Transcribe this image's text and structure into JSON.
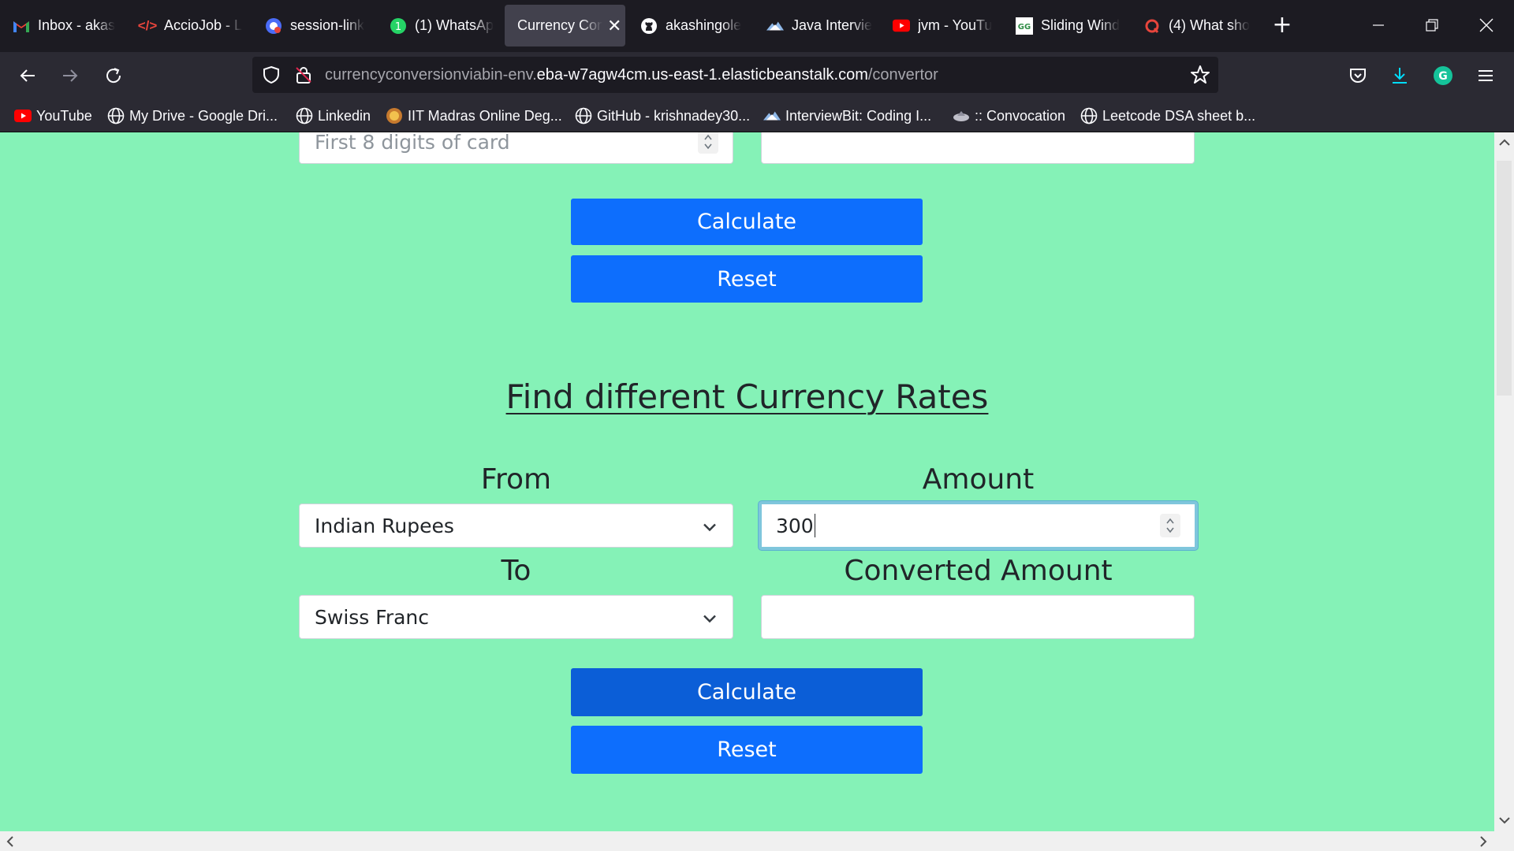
{
  "tabs": [
    {
      "title": "Inbox - akas",
      "icon": "gmail-icon",
      "active": false
    },
    {
      "title": "AccioJob - L",
      "icon": "acciojob-icon",
      "active": false
    },
    {
      "title": "session-link",
      "icon": "session-icon",
      "active": false
    },
    {
      "title": "(1) WhatsAp",
      "icon": "whatsapp-icon",
      "active": false
    },
    {
      "title": "Currency Con",
      "icon": "",
      "active": true
    },
    {
      "title": "akashingole",
      "icon": "github-icon",
      "active": false
    },
    {
      "title": "Java Intervie",
      "icon": "interviewbit-icon",
      "active": false
    },
    {
      "title": "jvm - YouTu",
      "icon": "youtube-icon",
      "active": false
    },
    {
      "title": "Sliding Wind",
      "icon": "gfg-icon",
      "active": false
    },
    {
      "title": "(4) What sho",
      "icon": "quora-icon",
      "active": false
    }
  ],
  "url": {
    "prefix": "currencyconversionviabin-env.",
    "domain": "eba-w7agw4cm.us-east-1.elasticbeanstalk.com",
    "path": "/convertor"
  },
  "bookmarks": [
    {
      "label": "YouTube",
      "icon": "youtube-icon"
    },
    {
      "label": "My Drive - Google Dri...",
      "icon": "globe-icon"
    },
    {
      "label": "Linkedin",
      "icon": "globe-icon"
    },
    {
      "label": "IIT Madras Online Deg...",
      "icon": "iitm-icon"
    },
    {
      "label": "GitHub - krishnadey30...",
      "icon": "globe-icon"
    },
    {
      "label": "InterviewBit: Coding I...",
      "icon": "interviewbit-icon"
    },
    {
      "label": ":: Convocation",
      "icon": "convocation-icon"
    },
    {
      "label": "Leetcode DSA sheet b...",
      "icon": "globe-icon"
    }
  ],
  "card_section": {
    "card_placeholder": "First 8 digits of card",
    "result_value": "",
    "calculate_label": "Calculate",
    "reset_label": "Reset"
  },
  "rates_section": {
    "heading": "Find different Currency Rates",
    "from_label": "From",
    "from_value": "Indian Rupees",
    "amount_label": "Amount",
    "amount_value": "300",
    "to_label": "To",
    "to_value": "Swiss Franc",
    "converted_label": "Converted Amount",
    "converted_value": "",
    "calculate_label": "Calculate",
    "reset_label": "Reset"
  },
  "colors": {
    "page_bg": "#85f2b7",
    "button_primary": "#0d6efd",
    "button_hover": "#0b5ed7",
    "tab_bar_bg": "#1c1b22",
    "toolbar_bg": "#2b2a33"
  }
}
